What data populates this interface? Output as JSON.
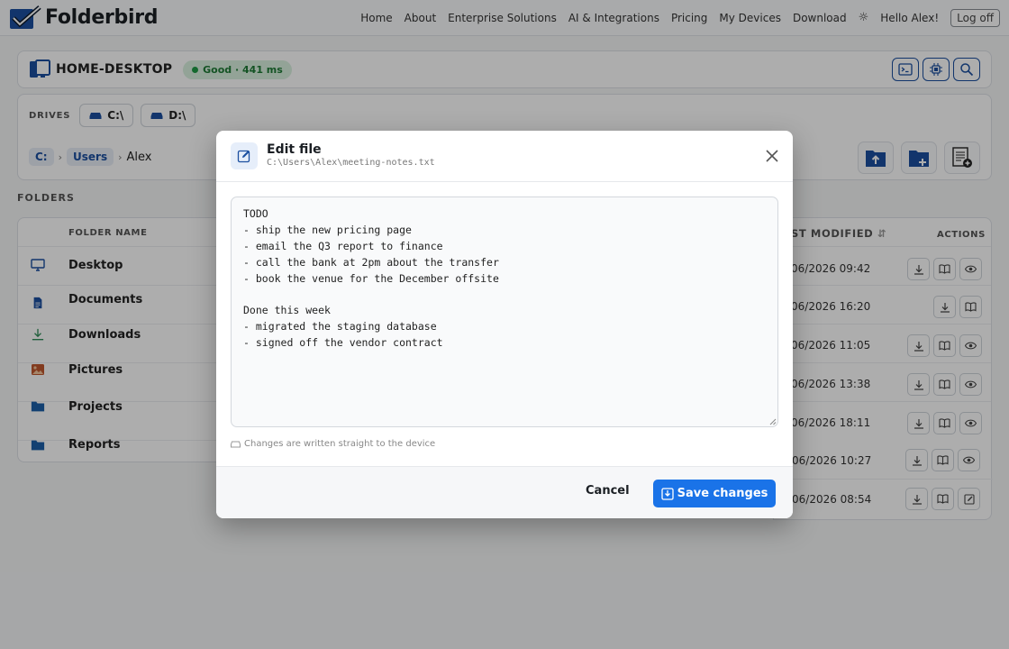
{
  "brand": {
    "name": "Folderbird"
  },
  "nav": {
    "items": [
      "Home",
      "About",
      "Enterprise Solutions",
      "AI & Integrations",
      "Pricing",
      "My Devices",
      "Download"
    ],
    "theme_icon": "sun-icon",
    "greeting": "Hello Alex!",
    "logoff_label": "Log off"
  },
  "device": {
    "name": "HOME-DESKTOP",
    "status": "Good · 441 ms",
    "status_color": "#1e9b45",
    "tools": [
      "terminal-icon",
      "chip-icon",
      "search-icon"
    ]
  },
  "drives": {
    "label": "DRIVES",
    "items": [
      "C:\\",
      "D:\\"
    ]
  },
  "breadcrumb": {
    "drive": "C:",
    "users": "Users",
    "current": "Alex"
  },
  "folders": {
    "section_label": "FOLDERS",
    "col_name": "FOLDER NAME",
    "col_modified": "ST MODIFIED",
    "col_actions": "ACTIONS",
    "rows": [
      {
        "name": "Desktop",
        "icon": "monitor-icon",
        "modified": "06/2026 09:42"
      },
      {
        "name": "Documents",
        "icon": "document-icon",
        "modified": "06/2026 16:20"
      },
      {
        "name": "Downloads",
        "icon": "download-icon",
        "modified": "06/2026 11:05"
      },
      {
        "name": "Pictures",
        "icon": "image-icon",
        "modified": "06/2026 13:38"
      },
      {
        "name": "Projects",
        "icon": "folder-icon",
        "modified": "06/2026 18:11"
      },
      {
        "name": "Reports",
        "icon": "folder-icon",
        "modified": "06/2026 10:27"
      },
      {
        "name": "",
        "icon": "",
        "modified": "06/2026 08:54"
      }
    ]
  },
  "modal": {
    "title": "Edit file",
    "path": "C:\\Users\\Alex\\meeting-notes.txt",
    "content": "TODO\n- ship the new pricing page\n- email the Q3 report to finance\n- call the bank at 2pm about the transfer\n- book the venue for the December offsite\n\nDone this week\n- migrated the staging database\n- signed off the vendor contract",
    "note": "Changes are written straight to the device",
    "cancel_label": "Cancel",
    "save_label": "Save changes",
    "accent": "#1a73e8"
  }
}
